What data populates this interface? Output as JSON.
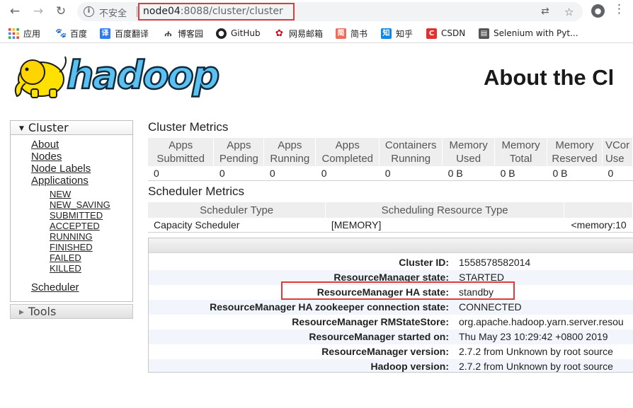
{
  "browser": {
    "insecure_label": "不安全",
    "url_host": "node04",
    "url_rest": ":8088/cluster/cluster",
    "profile_initial": "👤",
    "colors": {
      "highlight": "#e03a3a"
    }
  },
  "bookmarks": [
    {
      "label": "应用",
      "icon": "apps-grid-icon"
    },
    {
      "label": "百度",
      "icon": "baidu-paw-icon"
    },
    {
      "label": "百度翻译",
      "icon": "translate-icon"
    },
    {
      "label": "博客园",
      "icon": "cnblogs-icon"
    },
    {
      "label": "GitHub",
      "icon": "github-icon"
    },
    {
      "label": "网易邮箱",
      "icon": "netease-mail-icon"
    },
    {
      "label": "简书",
      "icon": "jianshu-icon"
    },
    {
      "label": "知乎",
      "icon": "zhihu-icon"
    },
    {
      "label": "CSDN",
      "icon": "csdn-icon"
    },
    {
      "label": "Selenium with Pyt...",
      "icon": "selenium-doc-icon"
    }
  ],
  "header": {
    "logo_text": "hadoop",
    "title": "About the Cl"
  },
  "nav": {
    "cluster_label": "Cluster",
    "about": "About",
    "nodes": "Nodes",
    "node_labels": "Node Labels",
    "applications": "Applications",
    "states": [
      "NEW",
      "NEW_SAVING",
      "SUBMITTED",
      "ACCEPTED",
      "RUNNING",
      "FINISHED",
      "FAILED",
      "KILLED"
    ],
    "scheduler": "Scheduler",
    "tools_label": "Tools"
  },
  "cluster_metrics": {
    "title": "Cluster Metrics",
    "headers": [
      [
        "Apps",
        "Submitted"
      ],
      [
        "Apps",
        "Pending"
      ],
      [
        "Apps",
        "Running"
      ],
      [
        "Apps",
        "Completed"
      ],
      [
        "Containers",
        "Running"
      ],
      [
        "Memory",
        "Used"
      ],
      [
        "Memory",
        "Total"
      ],
      [
        "Memory",
        "Reserved"
      ],
      [
        "VCor",
        "Use"
      ]
    ],
    "values": [
      "0",
      "0",
      "0",
      "0",
      "0",
      "0 B",
      "0 B",
      "0 B",
      "0"
    ]
  },
  "scheduler_metrics": {
    "title": "Scheduler Metrics",
    "headers": [
      "Scheduler Type",
      "Scheduling Resource Type",
      ""
    ],
    "values": [
      "Capacity Scheduler",
      "[MEMORY]",
      "<memory:10"
    ]
  },
  "cluster_info": [
    {
      "label": "Cluster ID:",
      "value": "1558578582014"
    },
    {
      "label": "ResourceManager state:",
      "value": "STARTED"
    },
    {
      "label": "ResourceManager HA state:",
      "value": "standby"
    },
    {
      "label": "ResourceManager HA zookeeper connection state:",
      "value": "CONNECTED"
    },
    {
      "label": "ResourceManager RMStateStore:",
      "value": "org.apache.hadoop.yarn.server.resou"
    },
    {
      "label": "ResourceManager started on:",
      "value": "Thu May 23 10:29:42 +0800 2019"
    },
    {
      "label": "ResourceManager version:",
      "value": "2.7.2 from Unknown by root source"
    },
    {
      "label": "Hadoop version:",
      "value": "2.7.2 from Unknown by root source"
    }
  ]
}
